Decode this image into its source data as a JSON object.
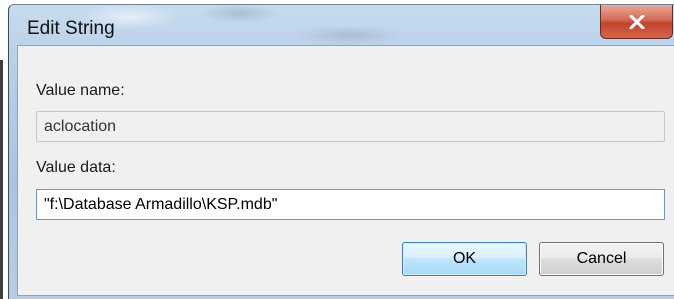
{
  "window": {
    "title": "Edit String",
    "close_icon": "close-icon"
  },
  "form": {
    "value_name_label": "Value name:",
    "value_name": "aclocation",
    "value_data_label": "Value data:",
    "value_data": "\"f:\\Database Armadillo\\KSP.mdb\""
  },
  "buttons": {
    "ok_label": "OK",
    "cancel_label": "Cancel"
  },
  "colors": {
    "close_button": "#c2432c",
    "ok_button_border": "#3c7fb1",
    "focus_border": "#5c9ad8",
    "dialog_background": "#f0f0f0"
  }
}
